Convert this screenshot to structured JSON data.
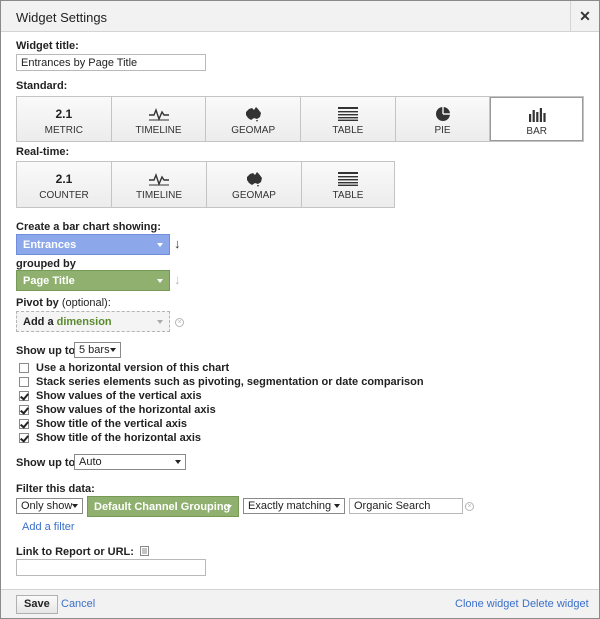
{
  "dialog": {
    "title": "Widget Settings",
    "close_glyph": "✕"
  },
  "widget_title": {
    "label": "Widget title:",
    "value": "Entrances by Page Title"
  },
  "standard": {
    "label": "Standard:",
    "buttons": [
      {
        "label": "METRIC",
        "icon_text": "2.1",
        "icon": "metric-icon"
      },
      {
        "label": "TIMELINE",
        "icon": "timeline-icon"
      },
      {
        "label": "GEOMAP",
        "icon": "geomap-icon"
      },
      {
        "label": "TABLE",
        "icon": "table-icon"
      },
      {
        "label": "PIE",
        "icon": "pie-icon"
      },
      {
        "label": "BAR",
        "icon": "bar-chart-icon",
        "selected": true
      }
    ]
  },
  "realtime": {
    "label": "Real-time:",
    "buttons": [
      {
        "label": "COUNTER",
        "icon_text": "2.1",
        "icon": "counter-icon"
      },
      {
        "label": "TIMELINE",
        "icon": "timeline-icon"
      },
      {
        "label": "GEOMAP",
        "icon": "geomap-icon"
      },
      {
        "label": "TABLE",
        "icon": "table-icon"
      }
    ]
  },
  "bar_chart": {
    "label": "Create a bar chart showing:",
    "metric": "Entrances",
    "grouped_by_label": "grouped by",
    "dimension": "Page Title"
  },
  "pivot": {
    "label": "Pivot by",
    "optional": "(optional):",
    "add_prefix": "Add a",
    "add_word": "dimension"
  },
  "show_up_to_bars": {
    "label": "Show up to",
    "value": "5 bars"
  },
  "options": [
    {
      "label": "Use a horizontal version of this chart",
      "checked": false
    },
    {
      "label": "Stack series elements such as pivoting, segmentation or date comparison",
      "checked": false
    },
    {
      "label": "Show values of the vertical axis",
      "checked": true
    },
    {
      "label": "Show values of the horizontal axis",
      "checked": true
    },
    {
      "label": "Show title of the vertical axis",
      "checked": true
    },
    {
      "label": "Show title of the horizontal axis",
      "checked": true
    }
  ],
  "show_up_to_auto": {
    "label": "Show up to",
    "value": "Auto"
  },
  "filter": {
    "label": "Filter this data:",
    "mode": "Only show",
    "dimension": "Default Channel Grouping",
    "match": "Exactly matching",
    "value": "Organic Search",
    "add_filter": "Add a filter"
  },
  "link": {
    "label": "Link to Report or URL:",
    "value": ""
  },
  "footer": {
    "save": "Save",
    "cancel": "Cancel",
    "clone": "Clone widget",
    "delete": "Delete widget"
  },
  "colors": {
    "metric_chip": "#8ca8ea",
    "dimension_chip": "#8fb06e",
    "link": "#3b6fc9"
  }
}
